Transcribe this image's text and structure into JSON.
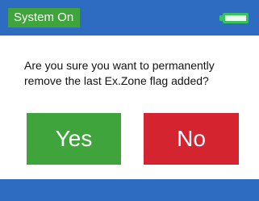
{
  "status_bar": {
    "status_label": "System On",
    "battery_icon": "battery-full-icon",
    "battery_level": 1.0,
    "colors": {
      "bar": "#2d6cc0",
      "status_bg": "#3fa43b",
      "battery": "#37c25a"
    }
  },
  "dialog": {
    "message_line1": "Are you sure you want to permanently",
    "message_line2": "remove the last Ex.Zone flag added?",
    "yes_label": "Yes",
    "no_label": "No",
    "colors": {
      "yes": "#3fa43b",
      "no": "#d42430"
    }
  },
  "footer": {
    "color": "#2d6cc0"
  }
}
